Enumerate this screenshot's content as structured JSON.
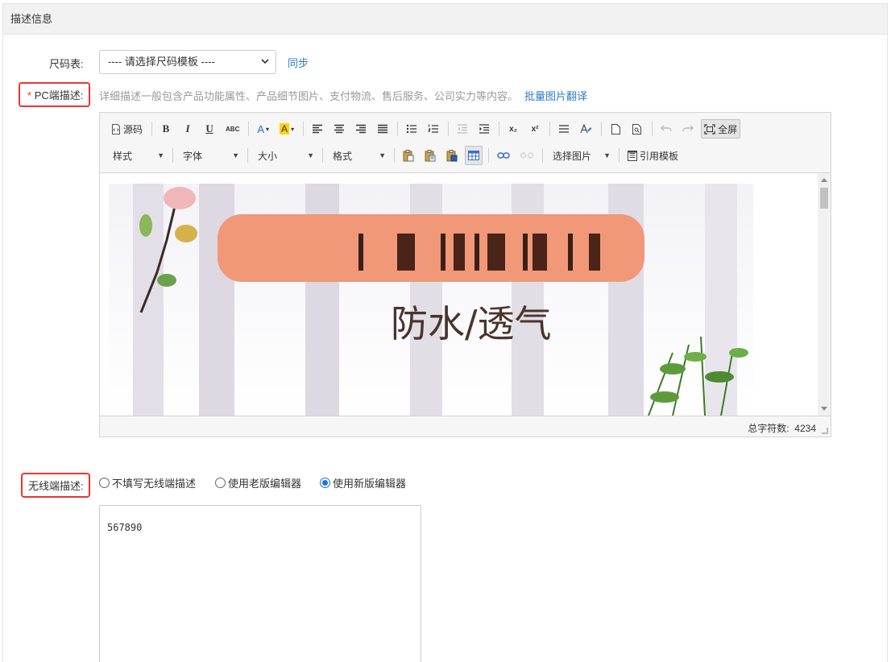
{
  "section": {
    "title": "描述信息"
  },
  "size_chart": {
    "label": "尺码表:",
    "select_value": "---- 请选择尺码模板 ----",
    "sync_link": "同步"
  },
  "pc_desc": {
    "required_mark": "*",
    "label": "PC端描述:",
    "hint": "详细描述一般包含产品功能属性、产品细节图片、支付物流、售后服务、公司实力等内容。",
    "batch_translate_link": "批量图片翻译"
  },
  "toolbar": {
    "row1": {
      "source": "源码",
      "bold": "B",
      "italic": "I",
      "underline": "U",
      "strike": "ABC",
      "font_color": "A",
      "bg_color": "A",
      "subscript": "x₂",
      "superscript": "x²",
      "fullscreen": "全屏"
    },
    "row2": {
      "style": "样式",
      "font": "字体",
      "size": "大小",
      "format": "格式",
      "select_image": "选择图片",
      "use_template": "引用模板"
    }
  },
  "editor_image": {
    "caption": "防水/透气"
  },
  "statusbar": {
    "char_count_label": "总字符数:",
    "char_count": "4234"
  },
  "mobile_desc": {
    "label": "无线端描述:",
    "options": [
      "不填写无线端描述",
      "使用老版编辑器",
      "使用新版编辑器"
    ],
    "selected_index": 2,
    "value": "567890"
  },
  "colors": {
    "link": "#2d7cc9",
    "highlight_border": "#e33333",
    "radio_checked": "#1a73e8"
  }
}
